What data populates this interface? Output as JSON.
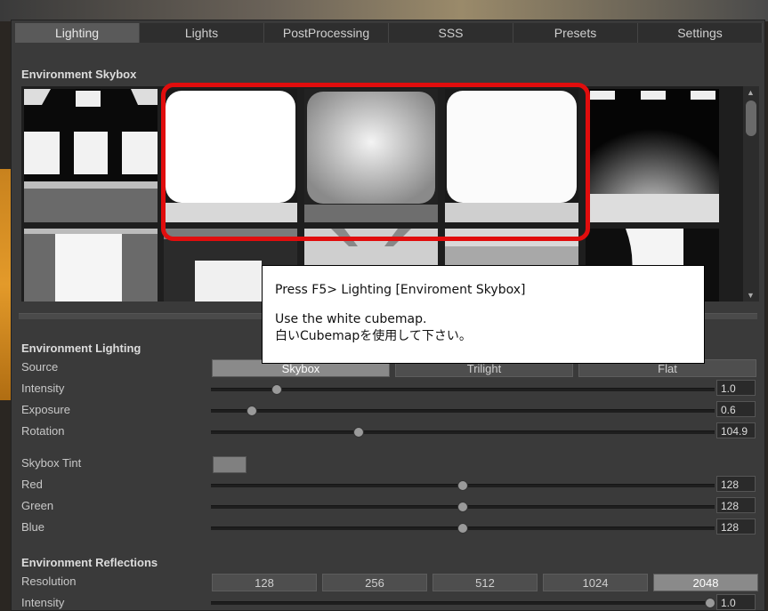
{
  "tabs": [
    "Lighting",
    "Lights",
    "PostProcessing",
    "SSS",
    "Presets",
    "Settings"
  ],
  "active_tab": "Lighting",
  "skybox": {
    "title": "Environment Skybox"
  },
  "lighting": {
    "title": "Environment Lighting",
    "source_label": "Source",
    "source_options": [
      "Skybox",
      "Trilight",
      "Flat"
    ],
    "source_selected": "Skybox",
    "intensity_label": "Intensity",
    "intensity_value": "1.0",
    "exposure_label": "Exposure",
    "exposure_value": "0.6",
    "rotation_label": "Rotation",
    "rotation_value": "104.9",
    "tint_label": "Skybox Tint",
    "red_label": "Red",
    "red_value": "128",
    "green_label": "Green",
    "green_value": "128",
    "blue_label": "Blue",
    "blue_value": "128",
    "tint_color": "#808080"
  },
  "reflections": {
    "title": "Environment Reflections",
    "resolution_label": "Resolution",
    "resolution_options": [
      "128",
      "256",
      "512",
      "1024",
      "2048"
    ],
    "resolution_selected": "2048",
    "intensity_label": "Intensity",
    "intensity_value": "1.0"
  },
  "callout": {
    "line1": "Press F5> Lighting [Enviroment Skybox]",
    "line2": "Use the white cubemap.",
    "line3": "白いCubemapを使用して下さい。"
  },
  "colors": {
    "highlight": "#e10d0d",
    "accent_orange": "#e39a2a"
  }
}
